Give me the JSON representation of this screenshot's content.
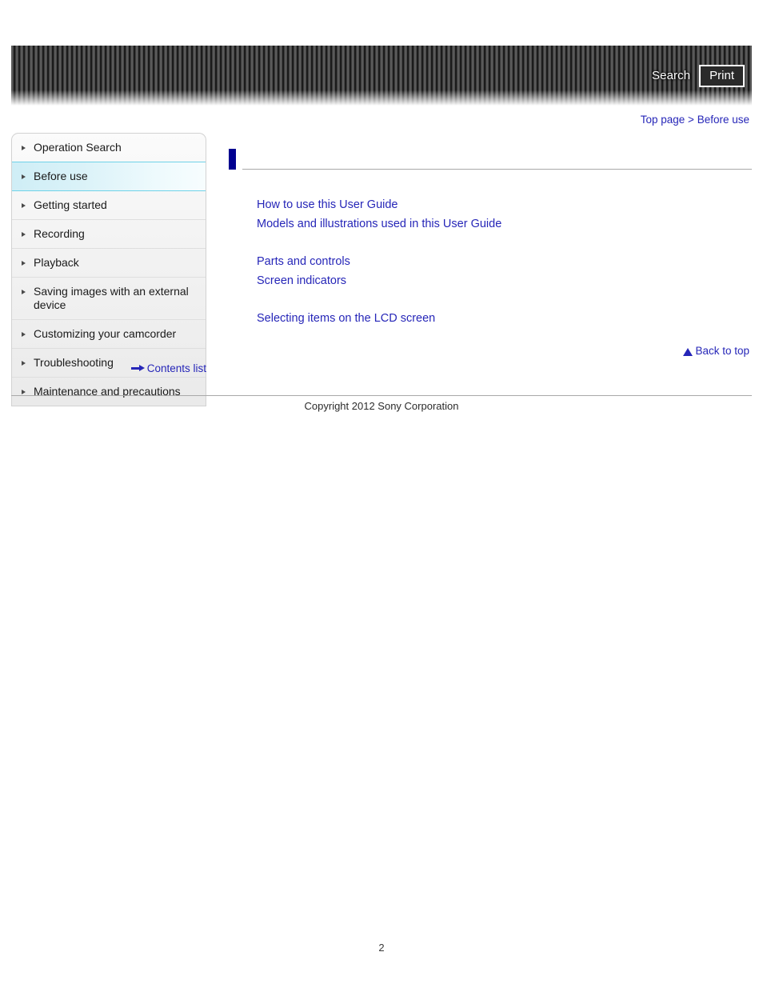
{
  "header": {
    "search_label": "Search",
    "print_label": "Print",
    "banner_name": "striped-banner"
  },
  "breadcrumb": {
    "top_page": "Top page",
    "separator": ">",
    "current": "Before use"
  },
  "sidebar": {
    "items": [
      {
        "label": "Operation Search",
        "active": false
      },
      {
        "label": "Before use",
        "active": true
      },
      {
        "label": "Getting started",
        "active": false
      },
      {
        "label": "Recording",
        "active": false
      },
      {
        "label": "Playback",
        "active": false
      },
      {
        "label": "Saving images with an external device",
        "active": false
      },
      {
        "label": "Customizing your camcorder",
        "active": false
      },
      {
        "label": "Troubleshooting",
        "active": false
      },
      {
        "label": "Maintenance and precautions",
        "active": false
      }
    ],
    "contents_list_label": "Contents list"
  },
  "main": {
    "title": "",
    "groups": [
      {
        "links": [
          "How to use this User Guide",
          "Models and illustrations used in this User Guide"
        ]
      },
      {
        "links": [
          "Parts and controls",
          "Screen indicators"
        ]
      },
      {
        "links": [
          "Selecting items on the LCD screen"
        ]
      }
    ],
    "back_to_top_label": "Back to top"
  },
  "footer": {
    "copyright": "Copyright 2012 Sony Corporation",
    "page_number": "2"
  },
  "colors": {
    "link": "#2626b8",
    "title_marker": "#000090",
    "active_border": "#6fd2e8"
  }
}
